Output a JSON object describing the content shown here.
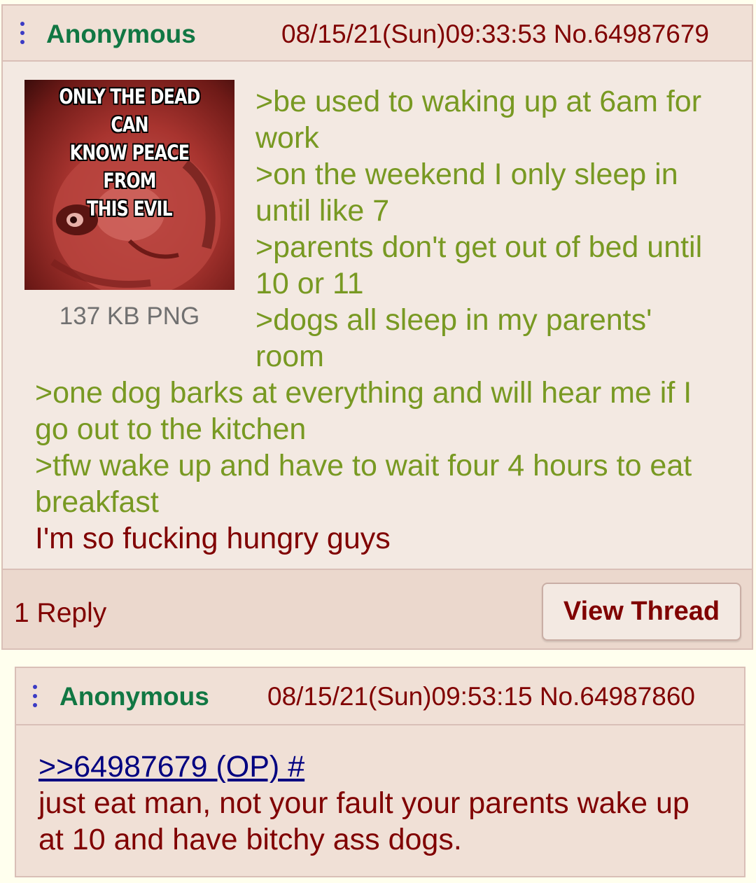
{
  "op": {
    "name": "Anonymous",
    "timestamp": "08/15/21(Sun)09:33:53",
    "post_no": "No.64987679",
    "image": {
      "caption_lines": [
        "ONLY THE DEAD CAN",
        "KNOW PEACE FROM",
        "THIS EVIL"
      ],
      "file_info": "137 KB PNG"
    },
    "lines": [
      ">be used to waking up at 6am for",
      "work",
      ">on the weekend I only sleep in",
      "until like 7",
      ">parents don't get out of bed until",
      "10 or 11",
      ">dogs all sleep in my parents'",
      "room",
      ">one dog barks at everything and will hear me if I",
      "go out to the kitchen",
      ">tfw wake up and have to wait four 4 hours to eat",
      "breakfast",
      "I'm so fucking hungry guys"
    ],
    "reply_count": "1 Reply",
    "view_thread_label": "View Thread"
  },
  "reply": {
    "name": "Anonymous",
    "timestamp": "08/15/21(Sun)09:53:15",
    "post_no": "No.64987860",
    "quote_link": ">>64987679 (OP) #",
    "lines": [
      "just eat man, not your fault your parents wake up",
      "at 10 and have bitchy ass dogs."
    ]
  },
  "colors": {
    "page_bg": "#FFFFEE",
    "post_bg": "#F0E0D6",
    "name": "#117743",
    "greentext": "#789922",
    "text": "#800000",
    "quote_link": "#000080",
    "file_info": "#707070",
    "menu_dots": "#3B3BC4"
  },
  "icons": {
    "post_menu": "vertical-ellipsis-icon"
  }
}
